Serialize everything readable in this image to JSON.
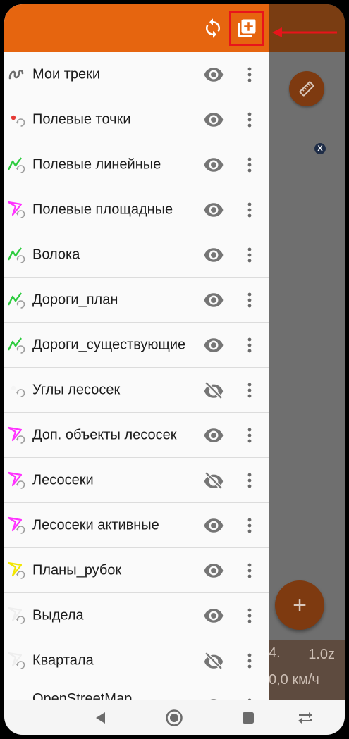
{
  "toolbar": {
    "sync_icon": "sync-icon",
    "add_layer_icon": "add-layer-icon",
    "bg_color": "#e6650f",
    "annotation_color": "#e8141b"
  },
  "layers": [
    {
      "label": "Мои треки",
      "icon": "track-icon",
      "visible": true
    },
    {
      "label": "Полевые точки",
      "icon": "point-layer-icon",
      "visible": true
    },
    {
      "label": "Полевые линейные",
      "icon": "line-layer-icon",
      "visible": true
    },
    {
      "label": "Полевые площадные",
      "icon": "polygon-layer-icon",
      "visible": true
    },
    {
      "label": "Волока",
      "icon": "line-layer-icon",
      "visible": true
    },
    {
      "label": "Дороги_план",
      "icon": "line-layer-icon",
      "visible": true
    },
    {
      "label": "Дороги_существующие",
      "icon": "line-layer-icon",
      "visible": true
    },
    {
      "label": "Углы лесосек",
      "icon": "point-layer-icon",
      "visible": false
    },
    {
      "label": "Доп. объекты лесосек",
      "icon": "polygon-layer-icon",
      "visible": true
    },
    {
      "label": "Лесосеки",
      "icon": "polygon-layer-icon",
      "visible": false
    },
    {
      "label": "Лесосеки активные",
      "icon": "polygon-layer-icon",
      "visible": true
    },
    {
      "label": "Планы_рубок",
      "icon": "polygon-layer-icon",
      "visible": true
    },
    {
      "label": "Выдела",
      "icon": "polygon-layer-icon",
      "visible": true
    },
    {
      "label": "Квартала",
      "icon": "polygon-layer-icon",
      "visible": false
    },
    {
      "label": "OpenStreetMap",
      "icon": "basemap-icon",
      "visible": true
    }
  ],
  "map": {
    "status_left": "4.",
    "status_right": "1.0z",
    "speed": "0,0 км/ч",
    "x_marker": "X",
    "add_fab_glyph": "+"
  },
  "navbar": {
    "back": "back-icon",
    "home": "home-icon",
    "recents": "recents-icon",
    "rotate": "rotate-icon"
  }
}
